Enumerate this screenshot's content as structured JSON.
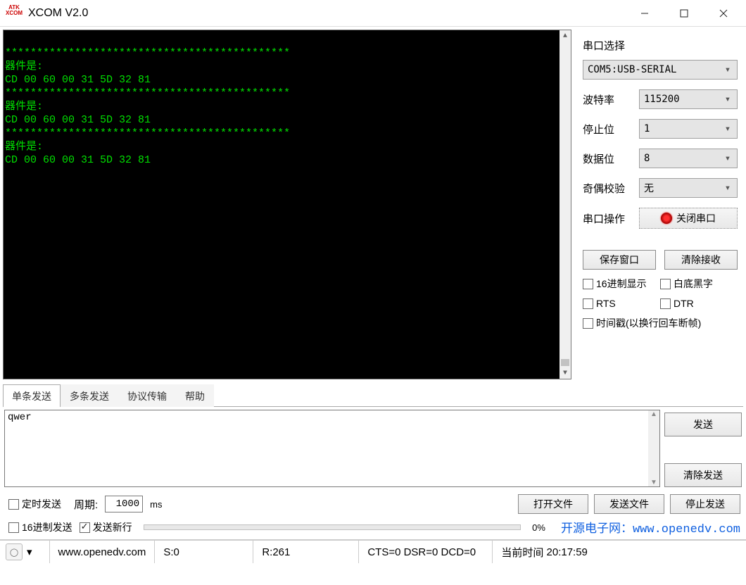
{
  "window": {
    "title": "XCOM V2.0"
  },
  "terminal": {
    "text": "*********************************************\n器件是:\nCD 00 60 00 31 5D 32 81 \n*********************************************\n器件是:\nCD 00 60 00 31 5D 32 81 \n*********************************************\n器件是:\nCD 00 60 00 31 5D 32 81 "
  },
  "side": {
    "title": "串口选择",
    "port": "COM5:USB-SERIAL",
    "baud": {
      "label": "波特率",
      "value": "115200"
    },
    "stop": {
      "label": "停止位",
      "value": "1"
    },
    "data": {
      "label": "数据位",
      "value": "8"
    },
    "parity": {
      "label": "奇偶校验",
      "value": "无"
    },
    "op": {
      "label": "串口操作",
      "button": "关闭串口"
    },
    "save_btn": "保存窗口",
    "clear_btn": "清除接收",
    "chk_hex_disp": "16进制显示",
    "chk_white_bg": "白底黑字",
    "chk_rts": "RTS",
    "chk_dtr": "DTR",
    "chk_timestamp": "时间戳(以换行回车断帧)"
  },
  "tabs": {
    "t0": "单条发送",
    "t1": "多条发送",
    "t2": "协议传输",
    "t3": "帮助"
  },
  "send": {
    "text": "qwer",
    "send_btn": "发送",
    "clear_btn": "清除发送"
  },
  "opts": {
    "timed": "定时发送",
    "period_label": "周期:",
    "period_value": "1000",
    "period_unit": "ms",
    "hex_send": "16进制发送",
    "send_newline": "发送新行",
    "progress_pct": "0%",
    "open_file": "打开文件",
    "send_file": "发送文件",
    "stop_send": "停止发送"
  },
  "link": {
    "label": "开源电子网：",
    "url": "www.openedv.com"
  },
  "status": {
    "website": "www.openedv.com",
    "sent": "S:0",
    "recv": "R:261",
    "signals": "CTS=0 DSR=0 DCD=0",
    "time_label": "当前时间",
    "time_value": "20:17:59"
  }
}
